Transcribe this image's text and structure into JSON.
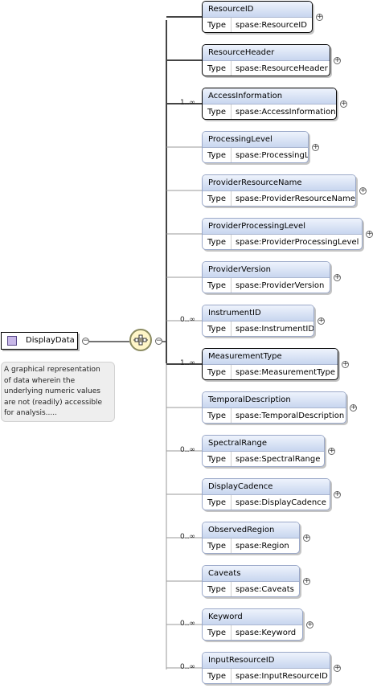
{
  "root": {
    "name": "DisplayData",
    "annotation": [
      "A graphical representation",
      "of data wherein the",
      "underlying numeric values",
      "are not (readily) accessible",
      "for analysis....."
    ]
  },
  "type_label": "Type",
  "colors": {
    "required_border": "#000000",
    "optional_border": "#9aa8c8",
    "header_gradient_top": "#eef3fc",
    "header_gradient_bottom": "#c8d6ef",
    "annotation_bg": "#eeeeee",
    "sequence_fill": "#fff6c8"
  },
  "icons": {
    "root": "element-icon",
    "sequence": "sequence-compositor-icon",
    "collapse": "minus-icon",
    "expand": "plus-icon"
  },
  "elements": [
    {
      "name": "ResourceID",
      "type": "spase:ResourceID",
      "cardinality": "",
      "required": true
    },
    {
      "name": "ResourceHeader",
      "type": "spase:ResourceHeader",
      "cardinality": "",
      "required": true
    },
    {
      "name": "AccessInformation",
      "type": "spase:AccessInformation",
      "cardinality": "1..∞",
      "required": true
    },
    {
      "name": "ProcessingLevel",
      "type": "spase:ProcessingLevel",
      "cardinality": "",
      "required": false
    },
    {
      "name": "ProviderResourceName",
      "type": "spase:ProviderResourceName",
      "cardinality": "",
      "required": false
    },
    {
      "name": "ProviderProcessingLevel",
      "type": "spase:ProviderProcessingLevel",
      "cardinality": "",
      "required": false
    },
    {
      "name": "ProviderVersion",
      "type": "spase:ProviderVersion",
      "cardinality": "",
      "required": false
    },
    {
      "name": "InstrumentID",
      "type": "spase:InstrumentID",
      "cardinality": "0..∞",
      "required": false
    },
    {
      "name": "MeasurementType",
      "type": "spase:MeasurementType",
      "cardinality": "1..∞",
      "required": true
    },
    {
      "name": "TemporalDescription",
      "type": "spase:TemporalDescription",
      "cardinality": "",
      "required": false
    },
    {
      "name": "SpectralRange",
      "type": "spase:SpectralRange",
      "cardinality": "0..∞",
      "required": false
    },
    {
      "name": "DisplayCadence",
      "type": "spase:DisplayCadence",
      "cardinality": "",
      "required": false
    },
    {
      "name": "ObservedRegion",
      "type": "spase:Region",
      "cardinality": "0..∞",
      "required": false
    },
    {
      "name": "Caveats",
      "type": "spase:Caveats",
      "cardinality": "",
      "required": false
    },
    {
      "name": "Keyword",
      "type": "spase:Keyword",
      "cardinality": "0..∞",
      "required": false
    },
    {
      "name": "InputResourceID",
      "type": "spase:InputResourceID",
      "cardinality": "0..∞",
      "required": false
    }
  ]
}
